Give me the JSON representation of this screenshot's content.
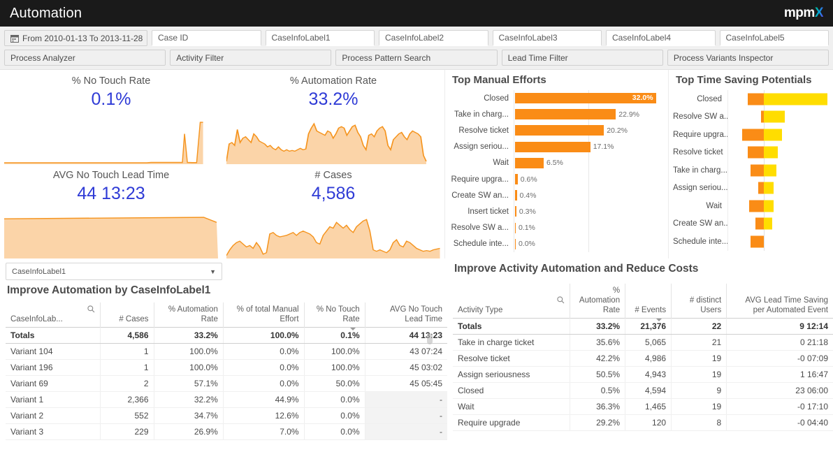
{
  "header": {
    "title": "Automation",
    "logo_m": "mpm",
    "logo_x": "X"
  },
  "filters": {
    "date_range": "From 2010-01-13 To 2013-11-28",
    "calendar_icon": "calendar-icon",
    "search_fields": [
      {
        "name": "case-id",
        "placeholder": "Case ID"
      },
      {
        "name": "caseinfolabel1",
        "placeholder": "CaseInfoLabel1"
      },
      {
        "name": "caseinfolabel2",
        "placeholder": "CaseInfoLabel2"
      },
      {
        "name": "caseinfolabel3",
        "placeholder": "CaseInfoLabel3"
      },
      {
        "name": "caseinfolabel4",
        "placeholder": "CaseInfoLabel4"
      },
      {
        "name": "caseinfolabel5",
        "placeholder": "CaseInfoLabel5"
      }
    ],
    "nav_buttons": [
      "Process Analyzer",
      "Activity Filter",
      "Process Pattern Search",
      "Lead Time Filter",
      "Process Variants Inspector"
    ]
  },
  "kpis": [
    {
      "label": "% No Touch Rate",
      "value": "0.1%"
    },
    {
      "label": "% Automation Rate",
      "value": "33.2%"
    },
    {
      "label": "AVG No Touch Lead Time",
      "value": "44 13:23"
    },
    {
      "label": "# Cases",
      "value": "4,586"
    }
  ],
  "chart_data": [
    {
      "type": "bar",
      "orientation": "horizontal",
      "title": "Top Manual Efforts",
      "xlabel": "",
      "ylabel": "",
      "xlim": [
        0,
        33.5
      ],
      "grid": true,
      "gridlines": [
        16.75
      ],
      "bar_color": "#fa8c16",
      "categories": [
        "Closed",
        "Take in charg...",
        "Resolve ticket",
        "Assign seriou...",
        "Wait",
        "Require upgra...",
        "Create SW an...",
        "Insert ticket",
        "Resolve SW a...",
        "Schedule inte..."
      ],
      "values": [
        32.0,
        22.9,
        20.2,
        17.1,
        6.5,
        0.6,
        0.4,
        0.3,
        0.1,
        0.0
      ],
      "value_labels": [
        "32.0%",
        "22.9%",
        "20.2%",
        "17.1%",
        "6.5%",
        "0.6%",
        "0.4%",
        "0.3%",
        "0.1%",
        "0.0%"
      ]
    },
    {
      "type": "bar",
      "orientation": "horizontal-diverging",
      "title": "Top Time Saving Potentials",
      "xlabel": "",
      "ylabel": "",
      "neg_color": "#fa8c16",
      "pos_color": "#ffdd00",
      "xlim": [
        -30,
        100
      ],
      "categories": [
        "Closed",
        "Resolve SW a...",
        "Require upgra...",
        "Resolve ticket",
        "Take in charg...",
        "Assign seriou...",
        "Wait",
        "Create SW an...",
        "Schedule inte..."
      ],
      "series": [
        {
          "name": "negative",
          "values": [
            -22,
            -4,
            -30,
            -22,
            -18,
            -8,
            -20,
            -12,
            -18
          ]
        },
        {
          "name": "positive",
          "values": [
            100,
            33,
            28,
            22,
            20,
            15,
            15,
            13,
            0
          ]
        }
      ]
    }
  ],
  "left_panel": {
    "select_value": "CaseInfoLabel1",
    "caret_icon": "chevron-down-icon",
    "title": "Improve Automation by CaseInfoLabel1",
    "search_icon": "search-icon",
    "sorted_column_index": 4,
    "columns": [
      "CaseInfoLab...",
      "# Cases",
      "% Automation Rate",
      "% of total Manual Effort",
      "% No Touch Rate",
      "AVG No Touch Lead Time"
    ],
    "totals": [
      "Totals",
      "4,586",
      "33.2%",
      "100.0%",
      "0.1%",
      "44 13:23"
    ],
    "rows": [
      [
        "Variant 104",
        "1",
        "100.0%",
        "0.0%",
        "100.0%",
        "43 07:24"
      ],
      [
        "Variant 196",
        "1",
        "100.0%",
        "0.0%",
        "100.0%",
        "45 03:02"
      ],
      [
        "Variant 69",
        "2",
        "57.1%",
        "0.0%",
        "50.0%",
        "45 05:45"
      ],
      [
        "Variant 1",
        "2,366",
        "32.2%",
        "44.9%",
        "0.0%",
        "-"
      ],
      [
        "Variant 2",
        "552",
        "34.7%",
        "12.6%",
        "0.0%",
        "-"
      ],
      [
        "Variant 3",
        "229",
        "26.9%",
        "7.0%",
        "0.0%",
        "-"
      ]
    ]
  },
  "right_panel": {
    "title": "Improve Activity Automation and Reduce Costs",
    "search_icon": "search-icon",
    "sorted_column_index": 2,
    "columns": [
      "Activity Type",
      "% Automation Rate",
      "# Events",
      "# distinct Users",
      "AVG Lead Time Saving per Automated Event"
    ],
    "column_lines": [
      [
        "Activity Type"
      ],
      [
        "%",
        "Automation",
        "Rate"
      ],
      [
        "# Events"
      ],
      [
        "# distinct",
        "Users"
      ],
      [
        "AVG Lead Time Saving",
        "per Automated Event"
      ]
    ],
    "totals": [
      "Totals",
      "33.2%",
      "21,376",
      "22",
      "9 12:14"
    ],
    "rows": [
      [
        "Take in charge ticket",
        "35.6%",
        "5,065",
        "21",
        "0 21:18"
      ],
      [
        "Resolve ticket",
        "42.2%",
        "4,986",
        "19",
        "-0 07:09"
      ],
      [
        "Assign seriousness",
        "50.5%",
        "4,943",
        "19",
        "1 16:47"
      ],
      [
        "Closed",
        "0.5%",
        "4,594",
        "9",
        "23 06:00"
      ],
      [
        "Wait",
        "36.3%",
        "1,465",
        "19",
        "-0 17:10"
      ],
      [
        "Require upgrade",
        "29.2%",
        "120",
        "8",
        "-0 04:40"
      ]
    ]
  },
  "colors": {
    "accent_orange": "#fa8c16",
    "accent_yellow": "#ffdd00",
    "kpi_blue": "#2f3bd6",
    "titlebar": "#1a1a1a"
  }
}
